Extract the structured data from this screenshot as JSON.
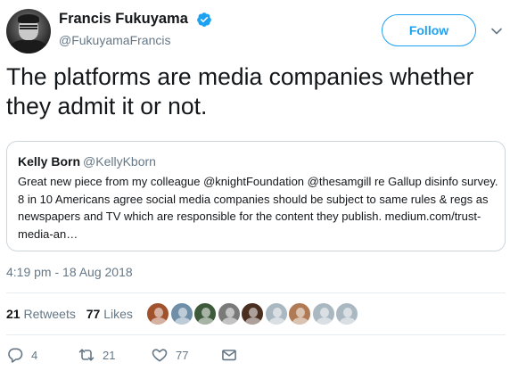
{
  "author": {
    "display_name": "Francis Fukuyama",
    "handle": "@FukuyamaFrancis",
    "verified": true
  },
  "follow_button": {
    "label": "Follow"
  },
  "tweet": {
    "text": "The platforms are media companies whether they admit it or not."
  },
  "quoted_tweet": {
    "display_name": "Kelly Born",
    "handle": "@KellyKborn",
    "text": "Great new piece from my colleague @knightFoundation @thesamgill re Gallup disinfo survey. 8 in 10 Americans agree social media companies should be subject to same rules & regs as newspapers and TV which are responsible for the content they publish. medium.com/trust-media-an…"
  },
  "timestamp": "4:19 pm - 18 Aug 2018",
  "stats": {
    "retweets_count": "21",
    "retweets_label": "Retweets",
    "likes_count": "77",
    "likes_label": "Likes"
  },
  "facepile_colors": [
    "#a0522d",
    "#6f8fa8",
    "#3d5a3a",
    "#7a7a7a",
    "#4a2e1f",
    "#aab8c2",
    "#b07a55",
    "#aab8c2",
    "#aab8c2"
  ],
  "actions": {
    "reply_count": "4",
    "retweet_count": "21",
    "like_count": "77"
  },
  "colors": {
    "accent": "#1da1f2",
    "secondary_text": "#657786",
    "border": "#ccd6dd"
  }
}
